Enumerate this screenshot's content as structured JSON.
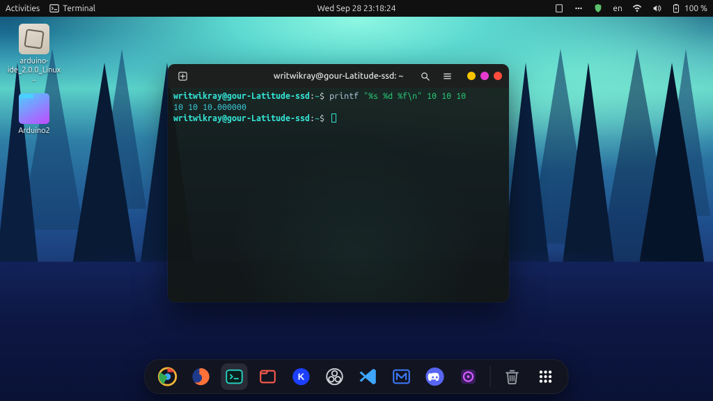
{
  "topbar": {
    "activities_label": "Activities",
    "app_label": "Terminal",
    "clock": "Wed Sep 28  23:18:24",
    "lang": "en",
    "battery": "100 %"
  },
  "desktop_icons": [
    {
      "name": "arduino-ide",
      "label": "arduino-ide_2.0.0_Linux.."
    },
    {
      "name": "arduino2-folder",
      "label": "Arduino2"
    }
  ],
  "terminal": {
    "title": "writwikray@gour-Latitude-ssd: ~",
    "prompt_user": "writwikray@gour-Latitude-ssd",
    "prompt_path": "~",
    "prompt_symbol": "$",
    "lines": [
      {
        "type": "cmd",
        "command": "printf",
        "arg_string": "\"%s %d %f\\n\"",
        "arg_tail": " 10 10 10"
      },
      {
        "type": "out",
        "text": "10 10 10.000000"
      },
      {
        "type": "prompt_empty"
      }
    ]
  },
  "dock": {
    "items": [
      {
        "name": "chrome",
        "color": "#f2b736"
      },
      {
        "name": "firefox",
        "color": "#ff7139"
      },
      {
        "name": "terminal",
        "color": "#24d4c4",
        "active": true
      },
      {
        "name": "files",
        "color": "#ff5c4d"
      },
      {
        "name": "kdenlive",
        "color": "#3d7bff"
      },
      {
        "name": "obs",
        "color": "#cfd3d6"
      },
      {
        "name": "vscode",
        "color": "#3ea6ff"
      },
      {
        "name": "mega",
        "color": "#3d7bff"
      },
      {
        "name": "discord",
        "color": "#5865f2"
      },
      {
        "name": "ubuntu-software",
        "color": "#b54bff"
      },
      {
        "name": "trash",
        "color": "#9aa0a6"
      },
      {
        "name": "show-apps",
        "color": "#ffffff"
      }
    ]
  }
}
